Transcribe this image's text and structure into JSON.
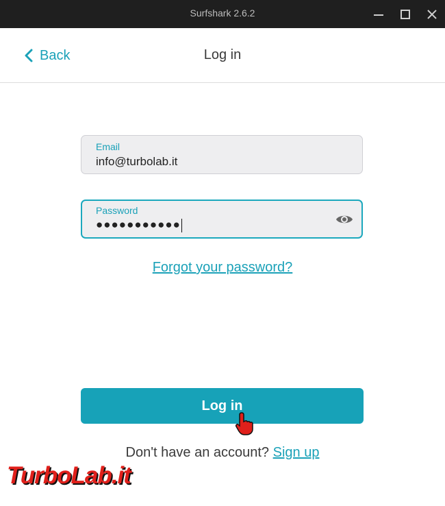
{
  "window": {
    "title": "Surfshark 2.6.2"
  },
  "header": {
    "back_label": "Back",
    "title": "Log in"
  },
  "form": {
    "email_label": "Email",
    "email_value": "info@turbolab.it",
    "password_label": "Password",
    "password_value": "●●●●●●●●●●●",
    "forgot_link": "Forgot your password?",
    "login_button": "Log in"
  },
  "footer": {
    "prompt": "Don't have an account?",
    "signup_link": "Sign up"
  },
  "watermark": "TurboLab.it",
  "colors": {
    "accent": "#17a2b8",
    "titlebar": "#1f1f1f",
    "watermark": "#e0201b"
  },
  "icons": [
    "minimize-icon",
    "maximize-icon",
    "close-icon",
    "chevron-left-icon",
    "eye-icon",
    "hand-pointer-icon"
  ]
}
